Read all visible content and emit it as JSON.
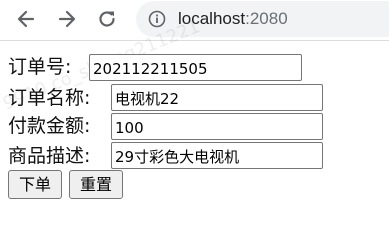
{
  "browser": {
    "url_host": "localhost",
    "url_port": ":2080"
  },
  "form": {
    "order_no": {
      "label": "订单号:",
      "value": "202112211505"
    },
    "order_name": {
      "label": "订单名称:",
      "value": "电视机22"
    },
    "payment_amount": {
      "label": "付款金额:",
      "value": "100"
    },
    "product_desc": {
      "label": "商品描述:",
      "value": "29寸彩色大电视机"
    },
    "submit_label": "下单",
    "reset_label": "重置"
  },
  "watermark": "9910 co_sh ong211221"
}
